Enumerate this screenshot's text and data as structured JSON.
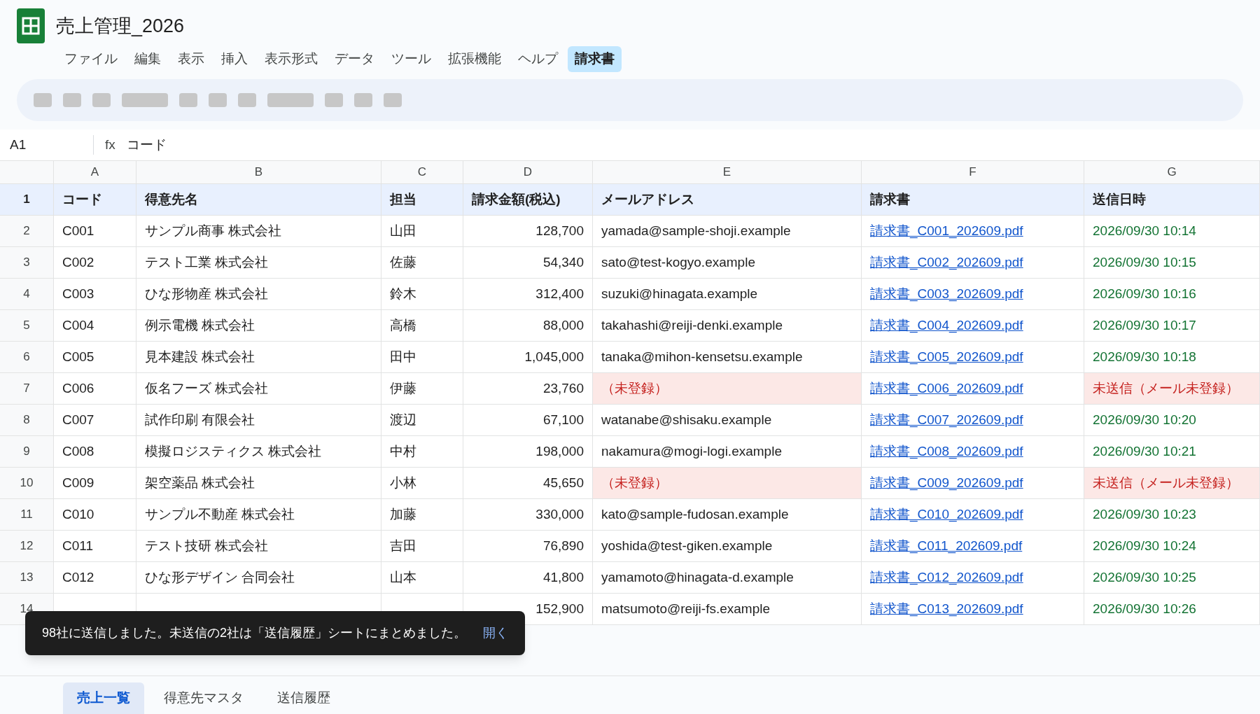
{
  "document": {
    "title": "売上管理_2026"
  },
  "menu": [
    {
      "label": "ファイル",
      "selected": false
    },
    {
      "label": "編集",
      "selected": false
    },
    {
      "label": "表示",
      "selected": false
    },
    {
      "label": "挿入",
      "selected": false
    },
    {
      "label": "表示形式",
      "selected": false
    },
    {
      "label": "データ",
      "selected": false
    },
    {
      "label": "ツール",
      "selected": false
    },
    {
      "label": "拡張機能",
      "selected": false
    },
    {
      "label": "ヘルプ",
      "selected": false
    },
    {
      "label": "請求書",
      "selected": true
    }
  ],
  "formula_bar": {
    "cell": "A1",
    "fx": "fx",
    "value": "コード"
  },
  "columns": [
    "A",
    "B",
    "C",
    "D",
    "E",
    "F",
    "G"
  ],
  "header_row": {
    "number": "1",
    "cells": [
      "コード",
      "得意先名",
      "担当",
      "請求金額(税込)",
      "メールアドレス",
      "請求書",
      "送信日時"
    ]
  },
  "rows": [
    {
      "number": "2",
      "kind": "sent",
      "cells": [
        "C001",
        "サンプル商事 株式会社",
        "山田",
        "128,700",
        "yamada@sample-shoji.example",
        "請求書_C001_202609.pdf",
        "2026/09/30 10:14"
      ]
    },
    {
      "number": "3",
      "kind": "sent",
      "cells": [
        "C002",
        "テスト工業 株式会社",
        "佐藤",
        "54,340",
        "sato@test-kogyo.example",
        "請求書_C002_202609.pdf",
        "2026/09/30 10:15"
      ]
    },
    {
      "number": "4",
      "kind": "sent",
      "cells": [
        "C003",
        "ひな形物産 株式会社",
        "鈴木",
        "312,400",
        "suzuki@hinagata.example",
        "請求書_C003_202609.pdf",
        "2026/09/30 10:16"
      ]
    },
    {
      "number": "5",
      "kind": "sent",
      "cells": [
        "C004",
        "例示電機 株式会社",
        "高橋",
        "88,000",
        "takahashi@reiji-denki.example",
        "請求書_C004_202609.pdf",
        "2026/09/30 10:17"
      ]
    },
    {
      "number": "6",
      "kind": "sent",
      "cells": [
        "C005",
        "見本建設 株式会社",
        "田中",
        "1,045,000",
        "tanaka@mihon-kensetsu.example",
        "請求書_C005_202609.pdf",
        "2026/09/30 10:18"
      ]
    },
    {
      "number": "7",
      "kind": "unsent",
      "cells": [
        "C006",
        "仮名フーズ 株式会社",
        "伊藤",
        "23,760",
        "（未登録）",
        "請求書_C006_202609.pdf",
        "未送信（メール未登録）"
      ]
    },
    {
      "number": "8",
      "kind": "sent",
      "cells": [
        "C007",
        "試作印刷 有限会社",
        "渡辺",
        "67,100",
        "watanabe@shisaku.example",
        "請求書_C007_202609.pdf",
        "2026/09/30 10:20"
      ]
    },
    {
      "number": "9",
      "kind": "sent",
      "cells": [
        "C008",
        "模擬ロジスティクス 株式会社",
        "中村",
        "198,000",
        "nakamura@mogi-logi.example",
        "請求書_C008_202609.pdf",
        "2026/09/30 10:21"
      ]
    },
    {
      "number": "10",
      "kind": "unsent",
      "cells": [
        "C009",
        "架空薬品 株式会社",
        "小林",
        "45,650",
        "（未登録）",
        "請求書_C009_202609.pdf",
        "未送信（メール未登録）"
      ]
    },
    {
      "number": "11",
      "kind": "sent",
      "cells": [
        "C010",
        "サンプル不動産 株式会社",
        "加藤",
        "330,000",
        "kato@sample-fudosan.example",
        "請求書_C010_202609.pdf",
        "2026/09/30 10:23"
      ]
    },
    {
      "number": "12",
      "kind": "sent",
      "cells": [
        "C011",
        "テスト技研 株式会社",
        "吉田",
        "76,890",
        "yoshida@test-giken.example",
        "請求書_C011_202609.pdf",
        "2026/09/30 10:24"
      ]
    },
    {
      "number": "13",
      "kind": "sent",
      "cells": [
        "C012",
        "ひな形デザイン 合同会社",
        "山本",
        "41,800",
        "yamamoto@hinagata-d.example",
        "請求書_C012_202609.pdf",
        "2026/09/30 10:25"
      ]
    },
    {
      "number": "14",
      "kind": "sent",
      "cells": [
        null,
        null,
        null,
        "152,900",
        "matsumoto@reiji-fs.example",
        "請求書_C013_202609.pdf",
        "2026/09/30 10:26"
      ]
    }
  ],
  "toast": {
    "message": "98社に送信しました。未送信の2社は「送信履歴」シートにまとめました。",
    "action": "開く"
  },
  "sheet_tabs": [
    {
      "label": "売上一覧",
      "selected": true
    },
    {
      "label": "得意先マスタ",
      "selected": false
    },
    {
      "label": "送信履歴",
      "selected": false
    }
  ]
}
